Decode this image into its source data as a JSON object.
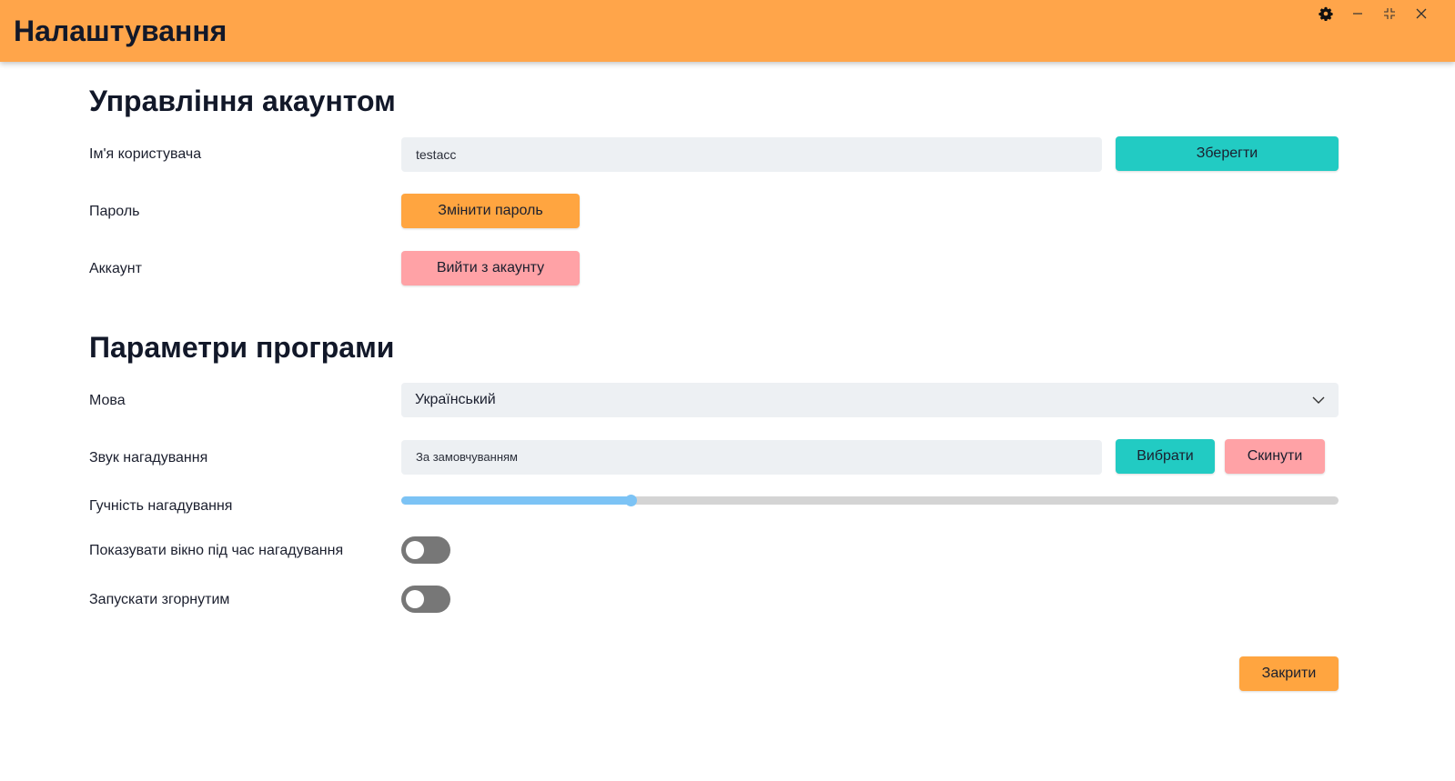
{
  "window": {
    "title": "Налаштування",
    "controls": [
      "gear-icon",
      "minimize-icon",
      "restore-icon",
      "close-icon"
    ]
  },
  "account": {
    "heading": "Управління акаунтом",
    "username_label": "Ім'я користувача",
    "username_value": "testacc",
    "save_label": "Зберегти",
    "password_label": "Пароль",
    "change_password_label": "Змінити пароль",
    "account_label": "Аккаунт",
    "logout_label": "Вийти з акаунту"
  },
  "app": {
    "heading": "Параметри програми",
    "language_label": "Мова",
    "language_value": "Український",
    "sound_label": "Звук нагадування",
    "sound_value": "За замовчуванням",
    "choose_label": "Вибрати",
    "reset_label": "Скинути",
    "volume_label": "Гучність нагадування",
    "volume_fraction": 0.246,
    "show_window_label": "Показувати вікно під час нагадування",
    "show_window_on": false,
    "start_minimized_label": "Запускати згорнутим",
    "start_minimized_on": false
  },
  "footer": {
    "close_label": "Закрити"
  },
  "colors": {
    "titlebar": "#ffa54a",
    "teal": "#22cbc3",
    "orange": "#ffa540",
    "pink": "#ffa2a6",
    "slider_fill": "#7cc3f5"
  }
}
